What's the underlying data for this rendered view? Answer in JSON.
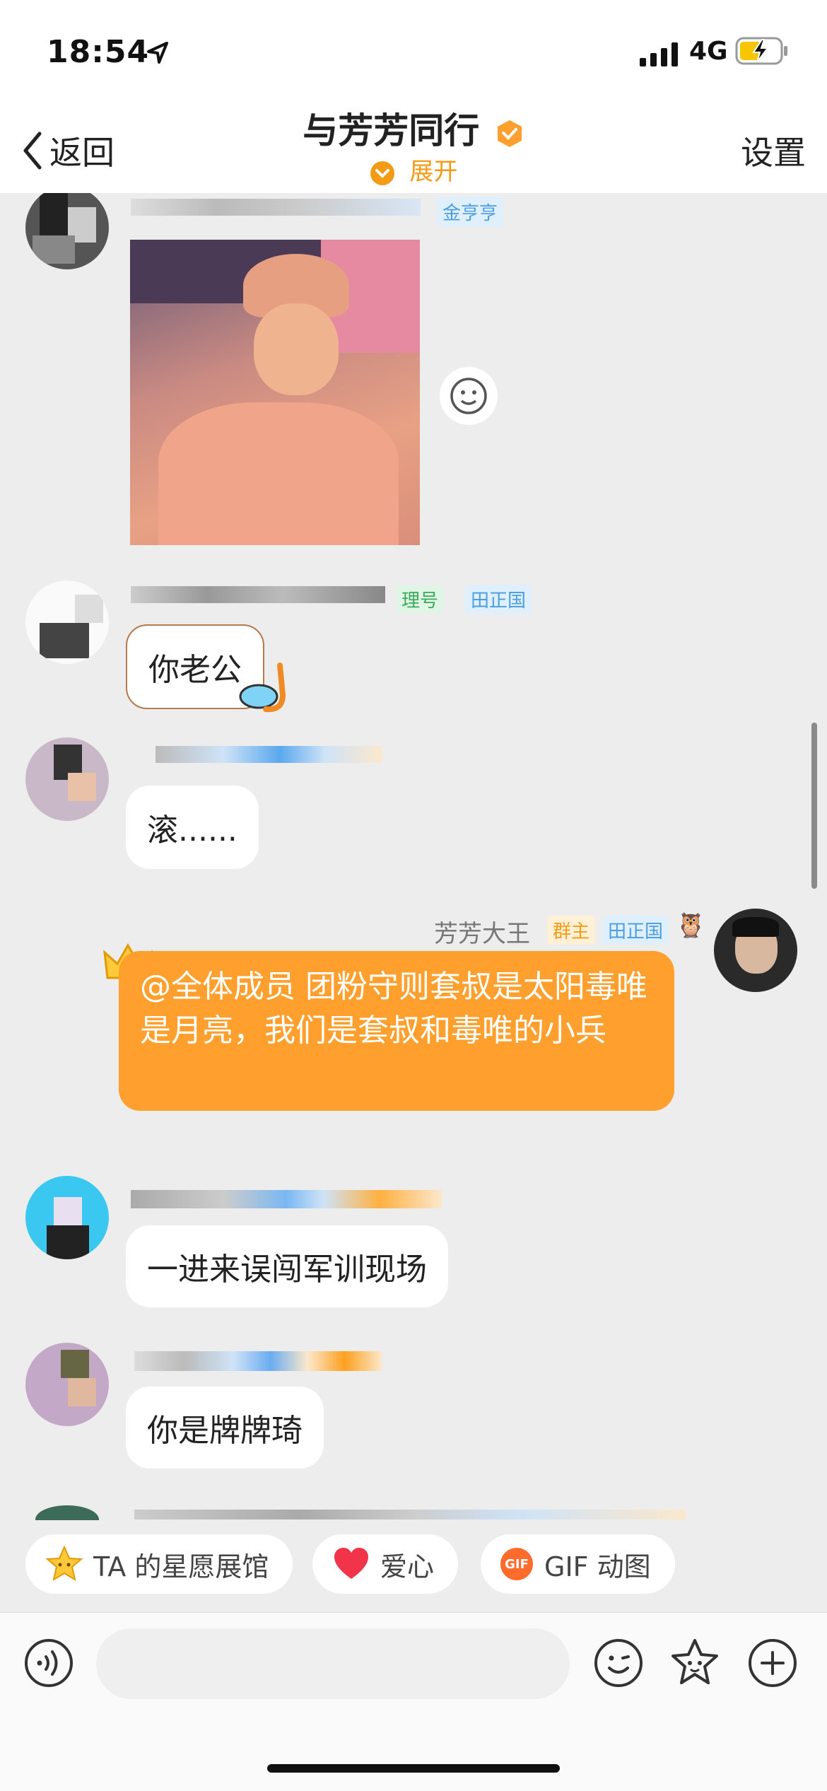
{
  "status_bar": {
    "time": "18:54",
    "network": "4G"
  },
  "nav": {
    "back_label": "返回",
    "title": "与芳芳同行",
    "expand_label": "展开",
    "settings_label": "设置"
  },
  "messages": [
    {
      "kind": "image",
      "tag": "金亨亨"
    },
    {
      "kind": "text",
      "tags": [
        "理号",
        "田正国"
      ],
      "text": "你老公"
    },
    {
      "kind": "text",
      "text": "滚......"
    },
    {
      "kind": "self",
      "sender": "芳芳大王",
      "tags": [
        "群主",
        "田正国"
      ],
      "text": "@全体成员 团粉守则套叔是太阳毒唯是月亮，我们是套叔和毒唯的小兵"
    },
    {
      "kind": "text",
      "text": "一进来误闯军训现场"
    },
    {
      "kind": "text",
      "text": "你是牌牌琦"
    }
  ],
  "quick_actions": [
    {
      "label": "TA 的星愿展馆",
      "icon": "star-icon"
    },
    {
      "label": "爱心",
      "icon": "heart-icon"
    },
    {
      "label": "GIF 动图",
      "icon": "gif-icon",
      "badge": "GIF"
    }
  ],
  "colors": {
    "accent": "#ffa02e",
    "chat_bg": "#ededed"
  }
}
